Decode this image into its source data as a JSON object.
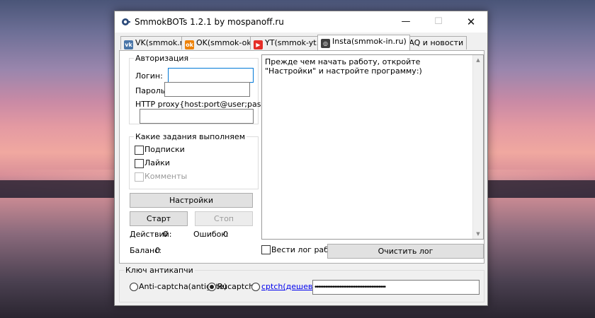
{
  "window": {
    "title": "SmmokBOTs 1.2.1 by mospanoff.ru"
  },
  "tabs": [
    {
      "label": "VK(smmok.ru)",
      "icon": "vk-icon"
    },
    {
      "label": "OK(smmok-ok.ru)",
      "icon": "odnoklassniki-icon"
    },
    {
      "label": "YT(smmok-yt.ru)",
      "icon": "youtube-icon"
    },
    {
      "label": "Insta(smmok-in.ru)",
      "icon": "instagram-icon",
      "active": true
    },
    {
      "label": "FAQ и новости",
      "icon": "question-icon"
    }
  ],
  "auth": {
    "group_label": "Авторизация",
    "login_label": "Логин:",
    "login_value": "",
    "password_label": "Пароль:",
    "password_value": "",
    "proxy_label": "HTTP proxy{host:port@user;password}",
    "proxy_value": ""
  },
  "tasks": {
    "group_label": "Какие задания выполняем",
    "items": [
      {
        "label": "Подписки",
        "checked": false,
        "enabled": true
      },
      {
        "label": "Лайки",
        "checked": false,
        "enabled": true
      },
      {
        "label": "Комменты",
        "checked": false,
        "enabled": false
      }
    ]
  },
  "buttons": {
    "settings": "Настройки",
    "start": "Старт",
    "stop": "Стоп",
    "clear_log": "Очистить лог"
  },
  "stats": {
    "actions_label": "Действий:",
    "actions_value": "0",
    "errors_label": "Ошибок:",
    "errors_value": "0",
    "balance_label": "Баланс:",
    "balance_value": "0"
  },
  "log": {
    "text": "Прежде чем начать работу, откройте \"Настройки\" и настройте программу:)",
    "keep_log_label": "Вести лог работы",
    "keep_log_checked": false
  },
  "captcha": {
    "group_label": "Ключ антикапчи",
    "options": [
      {
        "label": "Anti-captcha(antigate)",
        "selected": false
      },
      {
        "label": "Rucaptcha",
        "selected": true
      },
      {
        "label": "cptch(дешево)",
        "selected": false,
        "is_link": true
      }
    ],
    "key_value": "••••••••••••••••••••••••••••••••••••••••"
  },
  "colors": {
    "accent": "#0078d7",
    "link": "#0000ee",
    "window_bg": "#f0f0f0"
  }
}
